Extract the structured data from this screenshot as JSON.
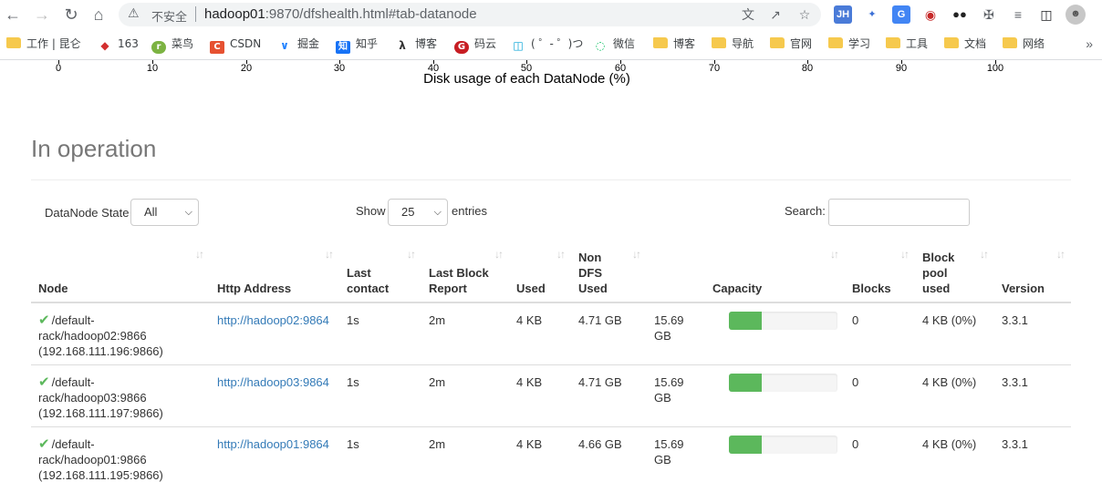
{
  "browser": {
    "insecure_label": "不安全",
    "url_host": "hadoop01",
    "url_rest": ":9870/dfshealth.html#tab-datanode",
    "bookmarks": [
      {
        "label": "工作 | 昆仑",
        "icon": "folder"
      },
      {
        "label": "163",
        "icon": "163-icon"
      },
      {
        "label": "菜鸟",
        "icon": "runoob-icon"
      },
      {
        "label": "CSDN",
        "icon": "csdn-icon"
      },
      {
        "label": "掘金",
        "icon": "juejin-icon"
      },
      {
        "label": "知乎",
        "icon": "zhihu-icon"
      },
      {
        "label": "博客",
        "icon": "cnblogs-icon"
      },
      {
        "label": "码云",
        "icon": "gitee-icon"
      },
      {
        "label": "( ゜- ゜)つ",
        "icon": "bilibili-icon"
      },
      {
        "label": "微信",
        "icon": "wechat-icon"
      },
      {
        "label": "博客",
        "icon": "folder"
      },
      {
        "label": "导航",
        "icon": "folder"
      },
      {
        "label": "官网",
        "icon": "folder"
      },
      {
        "label": "学习",
        "icon": "folder"
      },
      {
        "label": "工具",
        "icon": "folder"
      },
      {
        "label": "文档",
        "icon": "folder"
      },
      {
        "label": "网络",
        "icon": "folder"
      }
    ]
  },
  "chart": {
    "ticks": [
      "0",
      "10",
      "20",
      "30",
      "40",
      "50",
      "60",
      "70",
      "80",
      "90",
      "100"
    ],
    "axis_title": "Disk usage of each DataNode (%)"
  },
  "section": {
    "title": "In operation"
  },
  "controls": {
    "state_label": "DataNode State",
    "state_value": "All",
    "show_label": "Show",
    "show_value": "25",
    "entries_label": "entries",
    "search_label": "Search:"
  },
  "table": {
    "headers": [
      "Node",
      "Http Address",
      "Last contact",
      "Last Block Report",
      "Used",
      "Non DFS Used",
      "Capacity",
      "Blocks",
      "Block pool used",
      "Version"
    ],
    "rows": [
      {
        "node_line1": "/default-",
        "node_line2": "rack/hadoop02:9866",
        "node_line3": "(192.168.111.196:9866)",
        "http": "http://hadoop02:9864",
        "last_contact": "1s",
        "last_block_report": "2m",
        "used": "4 KB",
        "non_dfs_used": "4.71 GB",
        "capacity": "15.69 GB",
        "usage_fraction": 0.3,
        "blocks": "0",
        "block_pool_used": "4 KB (0%)",
        "version": "3.3.1"
      },
      {
        "node_line1": "/default-",
        "node_line2": "rack/hadoop03:9866",
        "node_line3": "(192.168.111.197:9866)",
        "http": "http://hadoop03:9864",
        "last_contact": "1s",
        "last_block_report": "2m",
        "used": "4 KB",
        "non_dfs_used": "4.71 GB",
        "capacity": "15.69 GB",
        "usage_fraction": 0.3,
        "blocks": "0",
        "block_pool_used": "4 KB (0%)",
        "version": "3.3.1"
      },
      {
        "node_line1": "/default-",
        "node_line2": "rack/hadoop01:9866",
        "node_line3": "(192.168.111.195:9866)",
        "http": "http://hadoop01:9864",
        "last_contact": "1s",
        "last_block_report": "2m",
        "used": "4 KB",
        "non_dfs_used": "4.66 GB",
        "capacity": "15.69 GB",
        "usage_fraction": 0.3,
        "blocks": "0",
        "block_pool_used": "4 KB (0%)",
        "version": "3.3.1"
      }
    ]
  },
  "colors": {
    "bar_fill": "#5cb85c",
    "link": "#337ab7",
    "ok": "#5cb85c"
  }
}
